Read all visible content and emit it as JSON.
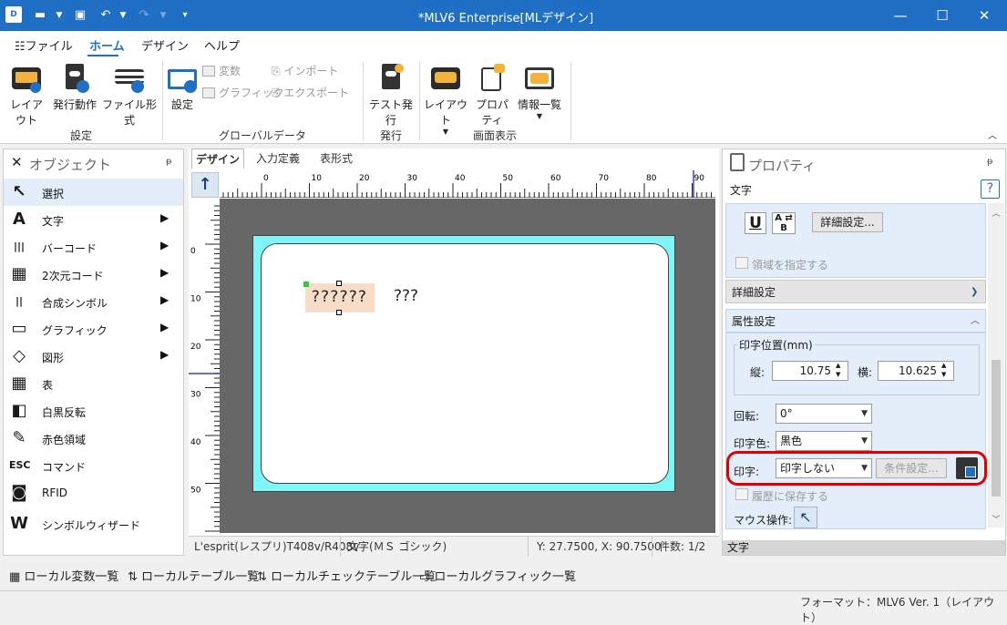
{
  "title": {
    "window_title": "*MLV6 Enterprise[MLデザイン]",
    "app_icon_text": "D"
  },
  "menu": {
    "file": "ファイル",
    "home": "ホーム",
    "design": "デザイン",
    "help": "ヘルプ"
  },
  "ribbon": {
    "layout": "レイアウト",
    "issue_action": "発行動作",
    "file_format": "ファイル形式",
    "settings": "設定",
    "variables": "変数",
    "graphic": "グラフィック",
    "import": "インポート",
    "export": "エクスポート",
    "test_issue": "テスト発行",
    "layout2": "レイアウト",
    "property": "プロパティ",
    "info_list": "情報一覧",
    "group_settings": "設定",
    "group_global": "グローバルデータ",
    "group_issue": "発行",
    "group_view": "画面表示"
  },
  "objects": {
    "title": "オブジェクト",
    "pin": "ᵽ",
    "items": [
      {
        "label": "選択",
        "icon": "↖"
      },
      {
        "label": "文字",
        "icon": "A"
      },
      {
        "label": "バーコード",
        "icon": "|||"
      },
      {
        "label": "2次元コード",
        "icon": "▦"
      },
      {
        "label": "合成シンボル",
        "icon": "||"
      },
      {
        "label": "グラフィック",
        "icon": "▭"
      },
      {
        "label": "図形",
        "icon": "◇"
      },
      {
        "label": "表",
        "icon": "▦"
      },
      {
        "label": "白黒反転",
        "icon": "◧"
      },
      {
        "label": "赤色領域",
        "icon": "✎"
      },
      {
        "label": "コマンド",
        "icon": "ESC"
      },
      {
        "label": "RFID",
        "icon": "◙"
      },
      {
        "label": "シンボルウィザード",
        "icon": "W"
      }
    ]
  },
  "design": {
    "tabs": [
      "デザイン",
      "入力定義",
      "表形式"
    ],
    "ruler_top_labels": [
      "0",
      "10",
      "20",
      "30",
      "40",
      "50",
      "60",
      "70",
      "80",
      "90"
    ],
    "ruler_left_labels": [
      "0",
      "10",
      "20",
      "30",
      "40",
      "50"
    ],
    "selected_text": "??????",
    "other_text": "???",
    "status_printer": "L'esprit(レスプリ)T408v/R408v",
    "status_object": "文字(ＭＳ ゴシック)",
    "status_coords": "Y: 27.7500, X: 90.7500",
    "status_count": "件数: 1/2"
  },
  "props": {
    "title": "プロパティ",
    "subtitle": "文字",
    "help": "?",
    "detail_button": "詳細設定...",
    "specify_region": "領域を指定する",
    "section_detail": "詳細設定",
    "section_attr": "属性設定",
    "print_pos_label": "印字位置(mm)",
    "vertical_label": "縦:",
    "vertical_value": "10.75",
    "horizontal_label": "横:",
    "horizontal_value": "10.625",
    "rotation_label": "回転:",
    "rotation_value": "0°",
    "color_label": "印字色:",
    "color_value": "黒色",
    "print_label": "印字:",
    "print_value": "印字しない",
    "condition_button": "条件設定...",
    "history_label": "履歴に保存する",
    "mouse_label": "マウス操作:",
    "bottom_label": "文字",
    "highlight_color": "#e00000"
  },
  "bottombar": {
    "local_vars": "ローカル変数一覧",
    "local_tables": "ローカルテーブル一覧",
    "local_check_tables": "ローカルチェックテーブル一覧",
    "local_graphics": "ローカルグラフィック一覧"
  },
  "footer": {
    "format": "フォーマット：MLV6 Ver. 1（レイアウト）"
  }
}
